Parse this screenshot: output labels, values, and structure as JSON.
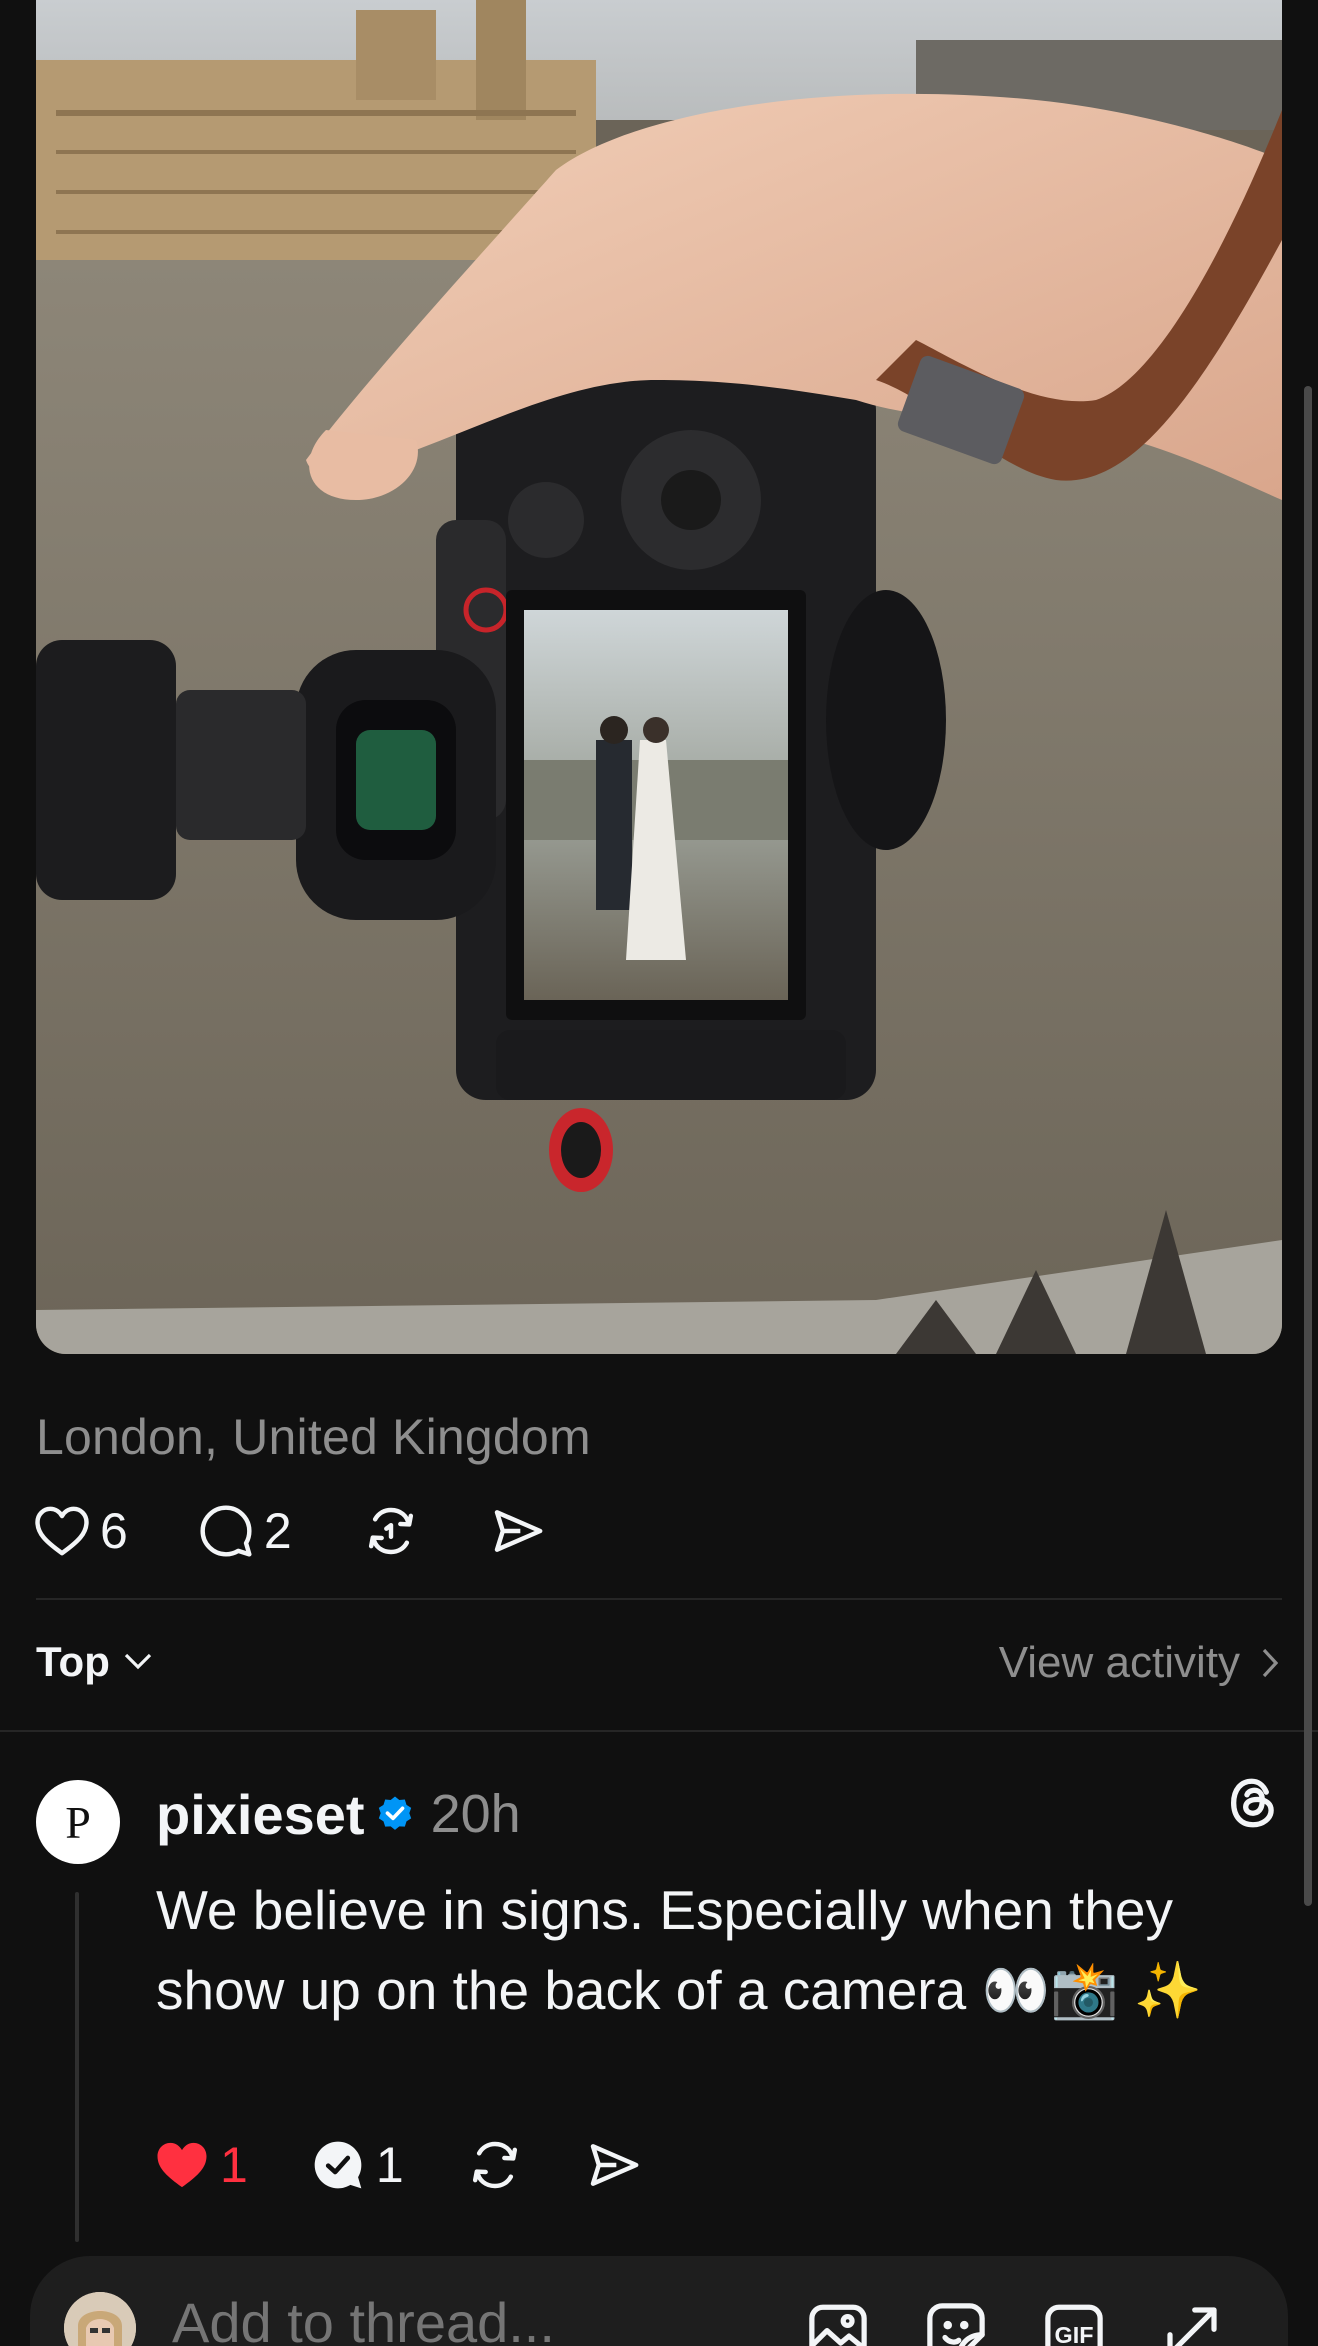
{
  "post": {
    "location": "London, United Kingdom",
    "likes": "6",
    "comments": "2"
  },
  "sort": {
    "label": "Top",
    "view_activity": "View activity"
  },
  "reply": {
    "avatar_letter": "P",
    "username": "pixieset",
    "verified": true,
    "time": "20h",
    "text": "We believe in signs. Especially when they show up on the back of a camera 👀📸 ✨",
    "likes": "1",
    "liked": true,
    "replies": "1"
  },
  "composer": {
    "placeholder": "Add to thread..."
  },
  "colors": {
    "background": "#101010",
    "text": "#f3f5f7",
    "muted": "#8e8e8e",
    "like": "#ff3040",
    "verified": "#0095f6"
  },
  "icons": {
    "photo": "camera-in-hand-over-river-photo",
    "like": "heart-icon",
    "comment": "comment-bubble-icon",
    "repost": "repost-icon",
    "share": "share-send-icon",
    "threads": "threads-logo-icon",
    "media": "gallery-icon",
    "sticker": "sticker-icon",
    "gif": "gif-icon",
    "expand": "expand-icon"
  }
}
